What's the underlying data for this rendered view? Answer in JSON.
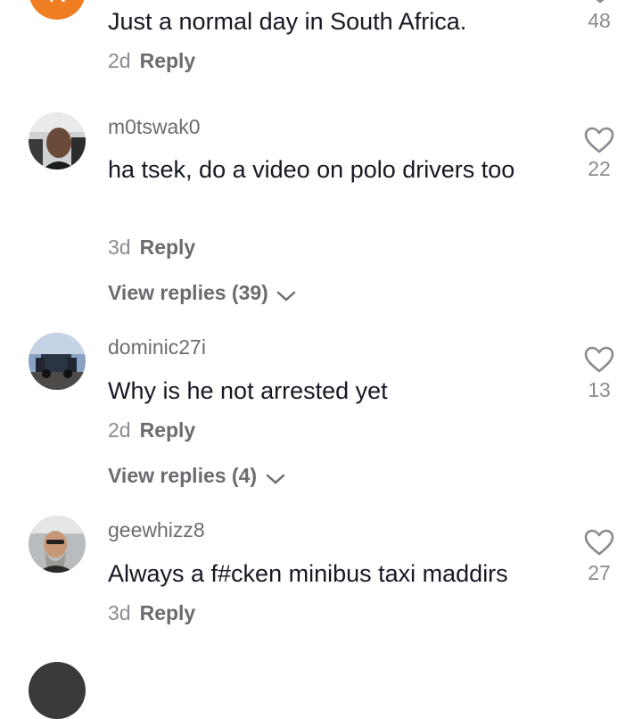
{
  "comments": [
    {
      "username": "",
      "avatar_color": "#ef7d22",
      "avatar_letter": "K",
      "text": "Just a normal day in South Africa.",
      "time": "2d",
      "reply_label": "Reply",
      "likes": "48"
    },
    {
      "username": "m0tswak0",
      "text": "ha tsek, do a video on polo drivers too",
      "time": "3d",
      "reply_label": "Reply",
      "likes": "22",
      "view_replies": "View replies (39)"
    },
    {
      "username": "dominic27i",
      "text": "Why is he not arrested yet",
      "time": "2d",
      "reply_label": "Reply",
      "likes": "13",
      "view_replies": "View replies (4)"
    },
    {
      "username": "geewhizz8",
      "text": "Always a f#cken minibus taxi maddirs",
      "time": "3d",
      "reply_label": "Reply",
      "likes": "27"
    }
  ]
}
